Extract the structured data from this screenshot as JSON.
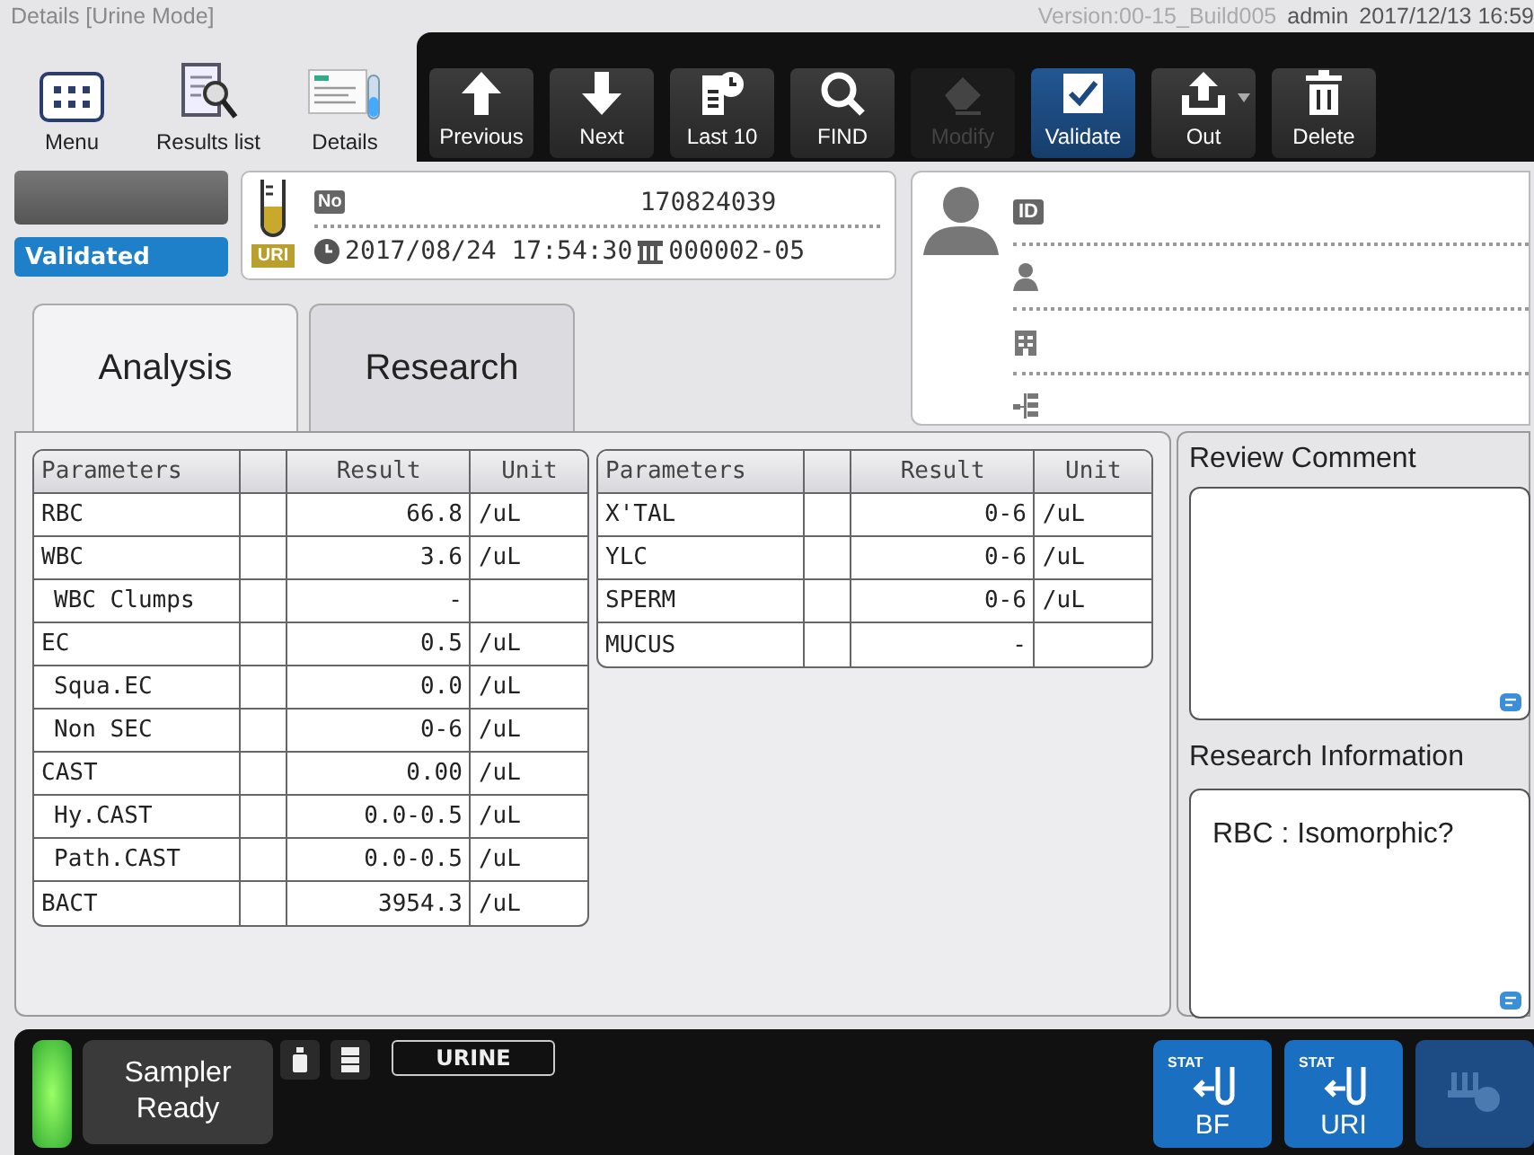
{
  "title_bar": {
    "title": "Details [Urine Mode]",
    "version": "Version:00-15_Build005",
    "user": "admin",
    "datetime": "2017/12/13 16:59"
  },
  "nav_buttons": [
    {
      "label": "Menu",
      "kind": "menu"
    },
    {
      "label": "Results list",
      "kind": "list"
    },
    {
      "label": "Details",
      "kind": "details"
    }
  ],
  "toolbar": [
    {
      "label": "Previous",
      "kind": "previous",
      "selected": false,
      "disabled": false,
      "dropdown": false
    },
    {
      "label": "Next",
      "kind": "next",
      "selected": false,
      "disabled": false,
      "dropdown": false
    },
    {
      "label": "Last 10",
      "kind": "recent",
      "selected": false,
      "disabled": false,
      "dropdown": false
    },
    {
      "label": "FIND",
      "kind": "find",
      "selected": false,
      "disabled": false,
      "dropdown": false
    },
    {
      "label": "Modify",
      "kind": "modify",
      "selected": false,
      "disabled": true,
      "dropdown": false
    },
    {
      "label": "Validate",
      "kind": "validate",
      "selected": true,
      "disabled": false,
      "dropdown": false
    },
    {
      "label": "Out",
      "kind": "out",
      "selected": false,
      "disabled": false,
      "dropdown": true
    },
    {
      "label": "Delete",
      "kind": "delete",
      "selected": false,
      "disabled": false,
      "dropdown": false
    }
  ],
  "sample": {
    "status": "Validated",
    "type": "URI",
    "number_label": "No",
    "number": "170824039",
    "datetime": "2017/08/24 17:54:30",
    "rack_position": "000002-05"
  },
  "patient": {
    "id_label": "ID"
  },
  "tabs": [
    {
      "label": "Analysis",
      "selected": true
    },
    {
      "label": "Research",
      "selected": false
    }
  ],
  "tables": [
    {
      "columns": {
        "parameter": "Parameters",
        "result": "Result",
        "unit": "Unit"
      },
      "rows": [
        {
          "parameter": "RBC",
          "result": "66.8",
          "unit": "/uL"
        },
        {
          "parameter": "WBC",
          "result": "3.6",
          "unit": "/uL",
          "children": [
            {
              "parameter": "WBC Clumps",
              "result": "-"
            }
          ]
        },
        {
          "parameter": "EC",
          "result": "0.5",
          "unit": "/uL",
          "children": [
            {
              "parameter": "Squa.EC",
              "result": "0.0",
              "unit": "/uL"
            },
            {
              "parameter": "Non SEC",
              "result": "0-6",
              "unit": "/uL"
            }
          ]
        },
        {
          "parameter": "CAST",
          "result": "0.00",
          "unit": "/uL",
          "children": [
            {
              "parameter": "Hy.CAST",
              "result": "0.0-0.5",
              "unit": "/uL"
            },
            {
              "parameter": "Path.CAST",
              "result": "0.0-0.5",
              "unit": "/uL"
            }
          ]
        },
        {
          "parameter": "BACT",
          "result": "3954.3",
          "unit": "/uL"
        }
      ]
    },
    {
      "columns": {
        "parameter": "Parameters",
        "result": "Result",
        "unit": "Unit"
      },
      "rows": [
        {
          "parameter": "X'TAL",
          "result": "0-6",
          "unit": "/uL"
        },
        {
          "parameter": "YLC",
          "result": "0-6",
          "unit": "/uL"
        },
        {
          "parameter": "SPERM",
          "result": "0-6",
          "unit": "/uL"
        },
        {
          "parameter": "MUCUS",
          "result": "-"
        }
      ]
    }
  ],
  "review_comment": {
    "title": "Review Comment"
  },
  "research_information": {
    "title": "Research Information",
    "value": "RBC : Isomorphic?"
  },
  "status_bar": {
    "sampler_status": "Sampler Ready",
    "ready": true,
    "mode": "URINE",
    "stat_buttons": [
      {
        "tag": "STAT",
        "label": "BF",
        "kind": "stat",
        "disabled": false
      },
      {
        "tag": "STAT",
        "label": "URI",
        "kind": "stat",
        "disabled": false
      },
      {
        "kind": "rack",
        "disabled": true
      }
    ]
  }
}
